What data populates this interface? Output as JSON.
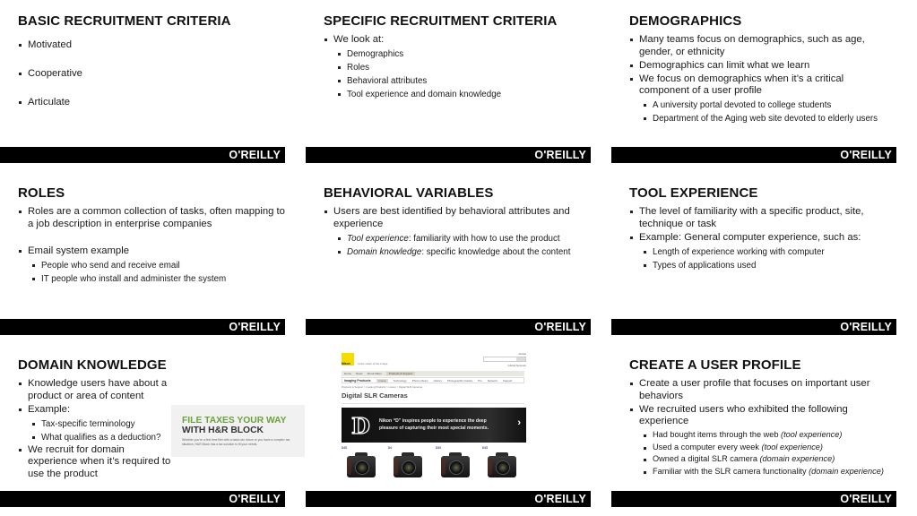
{
  "brand": {
    "logo_text": "O'REILLY",
    "footer_color": "#000000",
    "logo_color": "#ffffff"
  },
  "slides": [
    {
      "title": "BASIC RECRUITMENT CRITERIA",
      "bullets": [
        "Motivated",
        "Cooperative",
        "Articulate"
      ]
    },
    {
      "title": "SPECIFIC RECRUITMENT CRITERIA",
      "bullets": [
        {
          "text": "We look at:",
          "sub": [
            "Demographics",
            "Roles",
            "Behavioral attributes",
            "Tool experience and domain knowledge"
          ]
        }
      ]
    },
    {
      "title": "DEMOGRAPHICS",
      "bullets": [
        {
          "text": "Many teams focus on demographics, such as age, gender, or ethnicity"
        },
        {
          "text": "Demographics can limit what we learn"
        },
        {
          "text": "We focus on demographics when it’s a critical component of a user profile",
          "sub": [
            "A university portal devoted to college students",
            "Department of the Aging web site devoted to elderly users"
          ]
        }
      ]
    },
    {
      "title": "ROLES",
      "bullets": [
        {
          "text": "Roles are a common collection of tasks, often mapping to a job description in enterprise companies"
        },
        {
          "text": "Email system example",
          "sub": [
            "People who send and receive email",
            "IT people who install and administer the system"
          ]
        }
      ]
    },
    {
      "title": "BEHAVIORAL VARIABLES",
      "bullets": [
        {
          "text": "Users are best identified by behavioral attributes and experience",
          "sub": [
            {
              "em": "Tool experience",
              "rest": ": familiarity with how to use the product"
            },
            {
              "em": "Domain knowledge",
              "rest": ": specific knowledge about the content"
            }
          ]
        }
      ]
    },
    {
      "title": "TOOL EXPERIENCE",
      "bullets": [
        {
          "text": "The level of familiarity with a specific product, site, technique or task"
        },
        {
          "text": "Example: General computer experience, such as:",
          "sub": [
            "Length of experience working with computer",
            "Types of applications used"
          ]
        }
      ]
    },
    {
      "title": "DOMAIN KNOWLEDGE",
      "bullets": [
        {
          "text": "Knowledge users have about a product or area of content"
        },
        {
          "text": "Example:",
          "sub": [
            "Tax-specific terminology",
            "What qualifies as a deduction?"
          ]
        },
        {
          "text": "We recruit for domain experience when it’s required to use the product"
        }
      ],
      "ad": {
        "line1": "FILE TAXES YOUR WAY",
        "line2": "WITH H&R BLOCK",
        "subtext": "Whether you're a first time filer with a basic tax return or you have a complex tax situation, H&R Block has a tax solution to fit your needs.",
        "accent": "#6aa23b"
      }
    },
    {
      "title": "",
      "website": {
        "logo": "Nikon",
        "tagline": "At the Heart of the Image",
        "global_link": "Global",
        "search_button": "Search",
        "network_link": "Global Network",
        "nav_top": [
          "Home",
          "News",
          "About Nikon",
          "Products & Support"
        ],
        "nav_second": [
          "Imaging Products",
          "Lineup",
          "Technology",
          "Photo Library",
          "History",
          "Photographic Culture",
          "Pro",
          "Network",
          "Support"
        ],
        "breadcrumb": "Products & Support > Imaging Products > Lineup > Digital SLR Cameras",
        "page_heading": "Digital SLR Cameras",
        "banner_letter": "D",
        "banner_text_line1": "Nikon “D” inspires people to experience the deep",
        "banner_text_line2": "pleasure of capturing their most special moments.",
        "banner_arrow": "›",
        "cameras": [
          "D4S",
          "D4",
          "D3X",
          "D3S"
        ]
      }
    },
    {
      "title": "CREATE A USER PROFILE",
      "bullets": [
        {
          "text": "Create a user profile that focuses on important user behaviors"
        },
        {
          "text": "We recruited users who exhibited the following experience",
          "sub": [
            {
              "plain": "Had bought items through the web ",
              "em": "(tool experience)"
            },
            {
              "plain": "Used a computer every week ",
              "em": "(tool experience)"
            },
            {
              "plain": "Owned a digital SLR camera ",
              "em": "(domain experience)"
            },
            {
              "plain": "Familiar with the SLR camera functionality ",
              "em": "(domain experience)"
            }
          ]
        }
      ]
    }
  ]
}
